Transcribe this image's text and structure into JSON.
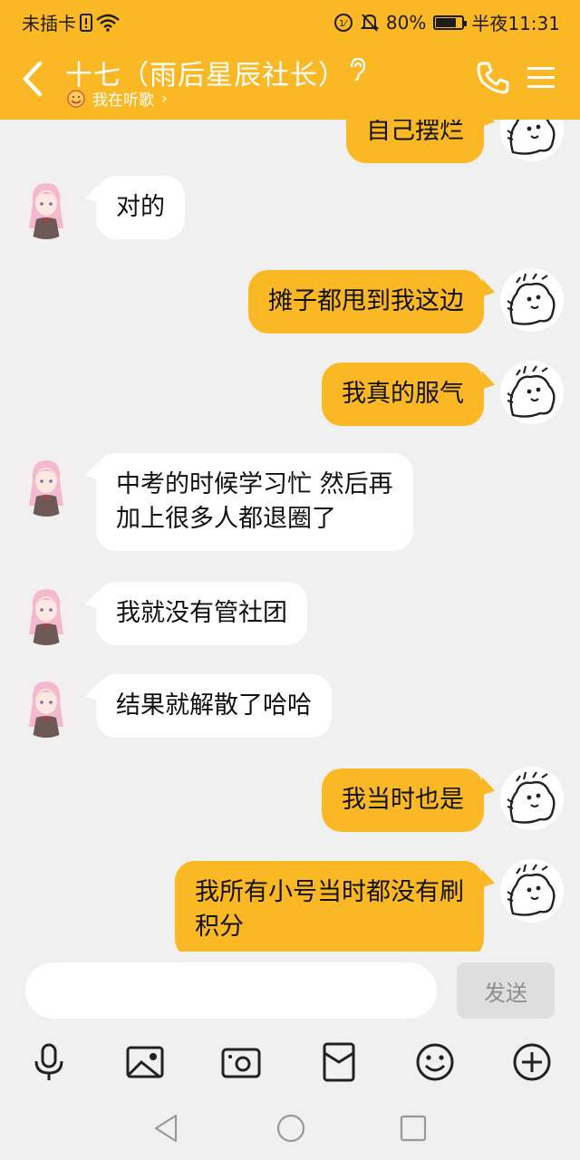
{
  "status": {
    "carrier": "未插卡",
    "battery": "80%",
    "battery_level": 0.8,
    "time": "半夜11:31"
  },
  "header": {
    "title": "十七（雨后星辰社长）",
    "subtitle": "我在听歌",
    "chevron": "›"
  },
  "messages": [
    {
      "side": "me",
      "text": "自己摆烂"
    },
    {
      "side": "them",
      "text": "对的"
    },
    {
      "side": "me",
      "text": "摊子都甩到我这边"
    },
    {
      "side": "me",
      "text": "我真的服气"
    },
    {
      "side": "them",
      "text": "中考的时候学习忙 然后再\n加上很多人都退圈了"
    },
    {
      "side": "them",
      "text": "我就没有管社团"
    },
    {
      "side": "them",
      "text": "结果就解散了哈哈"
    },
    {
      "side": "me",
      "text": "我当时也是"
    },
    {
      "side": "me",
      "text": "我所有小号当时都没有刷\n积分"
    }
  ],
  "input": {
    "value": "",
    "placeholder": ""
  },
  "send_label": "发送",
  "colors": {
    "accent": "#fbb825",
    "background": "#f0f0f0",
    "bubble_them": "#ffffff"
  },
  "icons": [
    "voice-icon",
    "image-icon",
    "camera-icon",
    "red-packet-icon",
    "emoji-icon",
    "plus-icon"
  ]
}
